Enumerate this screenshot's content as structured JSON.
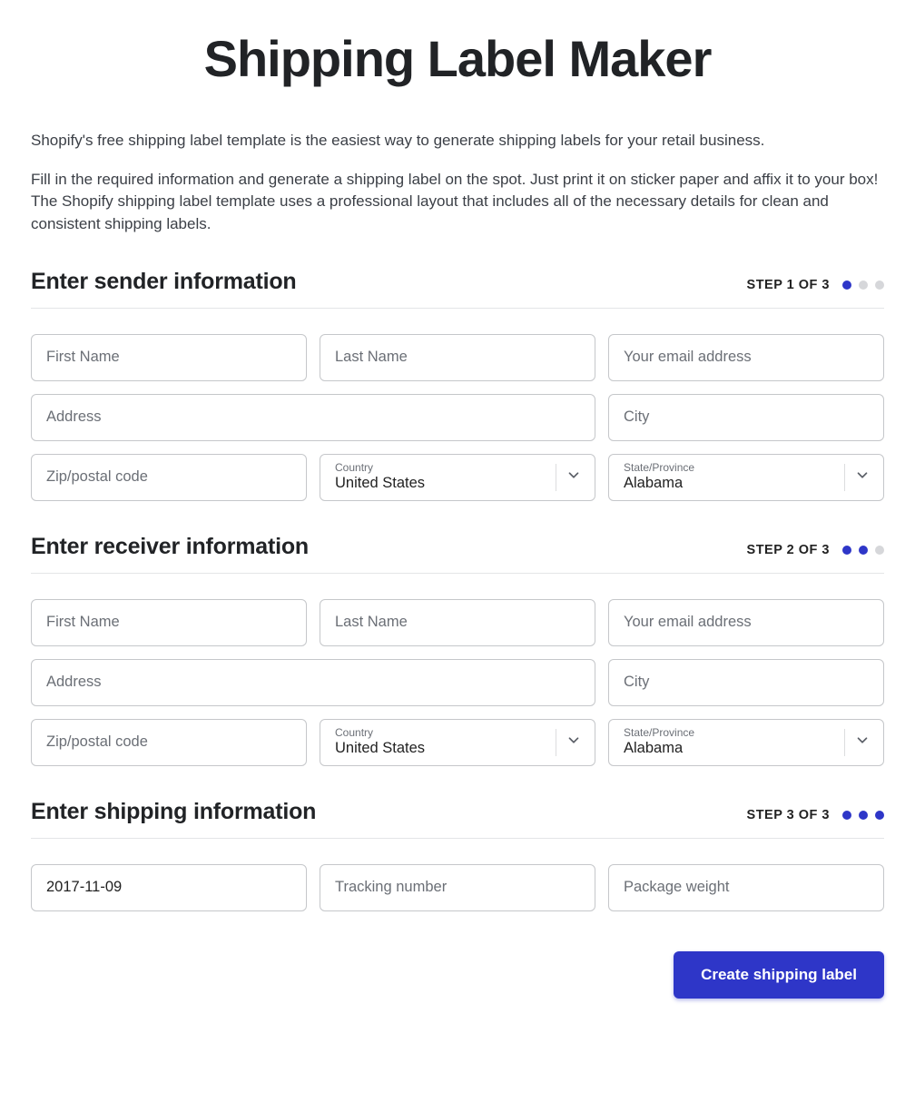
{
  "title": "Shipping Label Maker",
  "intro": {
    "p1": "Shopify's free shipping label template is the easiest way to generate shipping labels for your retail business.",
    "p2": "Fill in the required information and generate a shipping label on the spot. Just print it on sticker paper and affix it to your box! The Shopify shipping label template uses a professional layout that includes all of the necessary details for clean and consistent shipping labels."
  },
  "sections": {
    "sender": {
      "heading": "Enter sender information",
      "step": "STEP 1 OF 3"
    },
    "receiver": {
      "heading": "Enter receiver information",
      "step": "STEP 2 OF 3"
    },
    "shipping": {
      "heading": "Enter shipping information",
      "step": "STEP 3 OF 3"
    }
  },
  "placeholders": {
    "first_name": "First Name",
    "last_name": "Last Name",
    "email": "Your email address",
    "address": "Address",
    "city": "City",
    "zip": "Zip/postal code",
    "tracking": "Tracking number",
    "weight": "Package weight"
  },
  "selects": {
    "country_label": "Country",
    "state_label": "State/Province"
  },
  "sender": {
    "country": "United States",
    "state": "Alabama"
  },
  "receiver": {
    "country": "United States",
    "state": "Alabama"
  },
  "shipping": {
    "date": "2017-11-09"
  },
  "submit": "Create shipping label"
}
